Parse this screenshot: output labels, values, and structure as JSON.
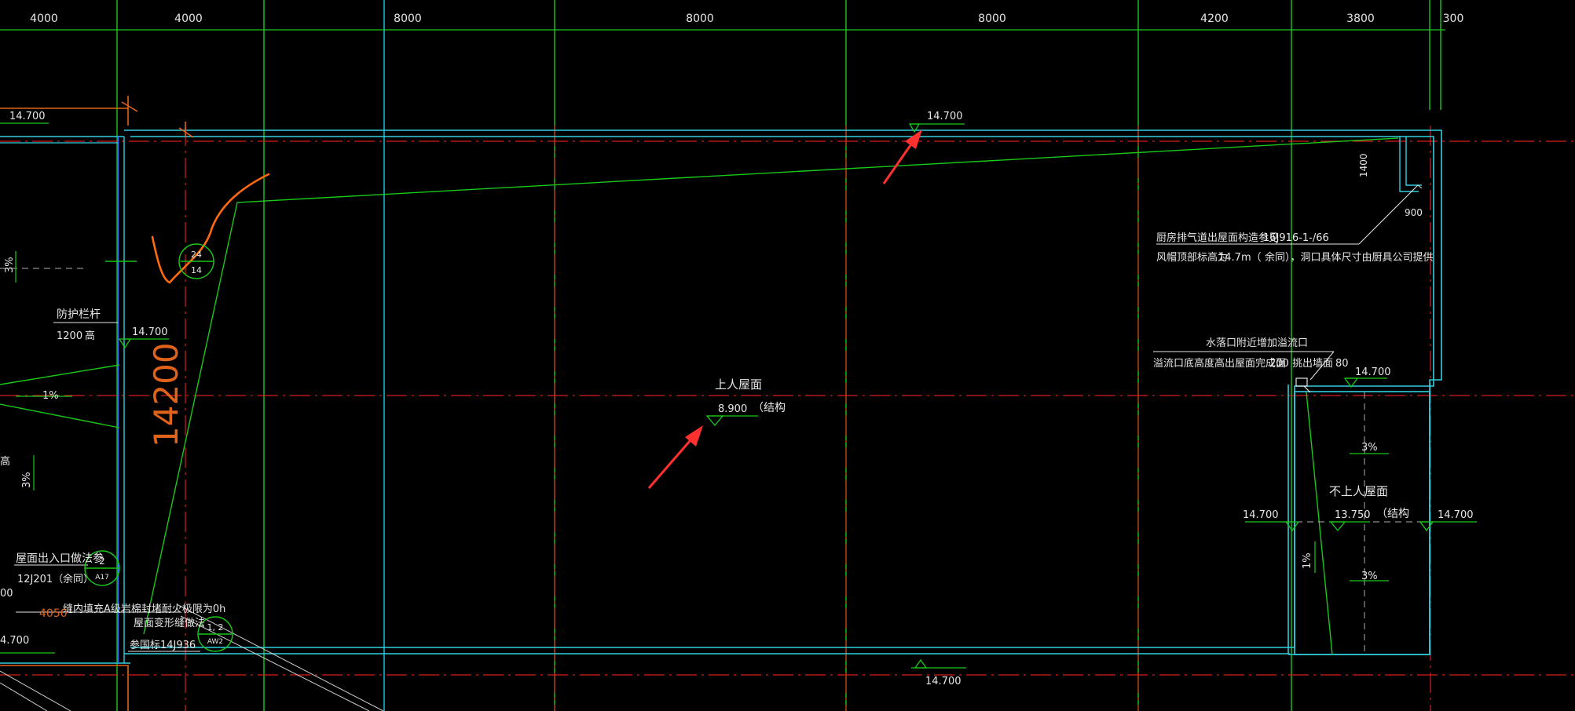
{
  "colors": {
    "background": "#000000",
    "grid_red": "#d91e1e",
    "grid_green": "#19c819",
    "grid_cyan": "#17b6c8",
    "wall_cyan": "#2fd0e0",
    "wall_blue": "#3a6cff",
    "annotation_white": "#e6e6e6",
    "arrow_red": "#ff3030",
    "dim_orange": "#e0631b",
    "scribble_orange": "#ff6a10"
  },
  "axis_dimensions": [
    "4000",
    "4000",
    "8000",
    "8000",
    "8000",
    "4200",
    "3800",
    "300"
  ],
  "elevations": {
    "top_left": "14.700",
    "top_center": "14.700",
    "left_rail": "14.700",
    "right_room_top": "14.700",
    "bottom_center": "14.700",
    "right_room_left": "14.700",
    "right_room_right": "14.700",
    "bottom_left": "4.700"
  },
  "main_roof": {
    "label": "上人屋面",
    "elevation": "8.900",
    "suffix": "（结构"
  },
  "right_room": {
    "label": "不上人屋面",
    "elevation": "13.750",
    "suffix": "（结构"
  },
  "slopes": {
    "left_top": "3%",
    "left_mid": "1%",
    "left_low": "3%",
    "right_upper": "3%",
    "right_lower": "3%",
    "right_vertical": "1%"
  },
  "notes": {
    "kitchen_line1": "厨房排气道出屋面构造参见",
    "kitchen_ref": "16J916-1-/66",
    "kitchen_line2": "风帽顶部标高为",
    "kitchen_val": "14.7m（",
    "kitchen_rest": "余同），洞口具体尺寸由厨具公司提供",
    "overflow_line1": "水落口附近增加溢流口",
    "overflow_line2": "溢流口底高度高出屋面完成面",
    "overflow_val": "200",
    "overflow_rest": "挑出墙面",
    "overflow_dim": "80",
    "guardrail": "防护栏杆",
    "guardrail_h": "1200",
    "guardrail_unit": "高",
    "roof_exit": "屋面出入口做法参",
    "roof_exit_ref": "12J201（",
    "roof_exit_same": "余同）",
    "fire_joint": "缝内填充A级岩棉封堵耐火极限为0h",
    "deform_joint": "屋面变形缝做法",
    "deform_ref": "参国标14J936",
    "left_partial": "高",
    "left_partial2": "00"
  },
  "dims": {
    "vertical_1400": "1400",
    "horizontal_900": "900",
    "big_14200": "14200",
    "orange_4050": "4050"
  },
  "detail_callouts": {
    "c1_top": "24",
    "c1_bottom": "14",
    "c2_top": "2",
    "c2_bottom": "A17",
    "c3_top": "1, 2",
    "c3_bottom": "AW2"
  }
}
